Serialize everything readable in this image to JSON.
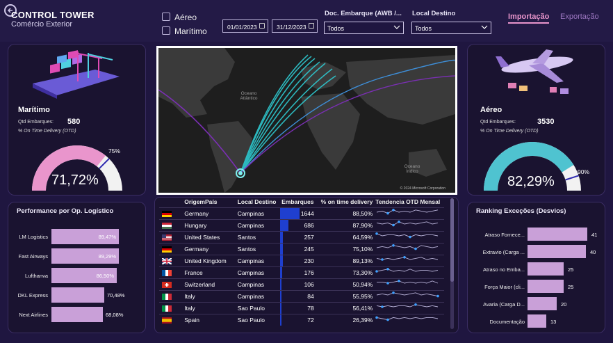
{
  "header": {
    "title": "CONTROL TOWER",
    "subtitle": "Comércio Exterior",
    "filters": {
      "aereo": "Aéreo",
      "maritimo": "Marítimo"
    },
    "date_start": "01/01/2023",
    "date_end": "31/12/2023",
    "doc_label": "Doc. Embarque (AWB /...",
    "doc_value": "Todos",
    "destino_label": "Local Destino",
    "destino_value": "Todos",
    "tab_import": "Importação",
    "tab_export": "Exportação"
  },
  "maritimo": {
    "title": "Marítimo",
    "qtd_label": "Qtd Embarques:",
    "qtd_value": "580",
    "otd_label": "% On Time Delivery (OTD)",
    "gauge_value": "71,72%",
    "gauge_target": "75%",
    "gauge_fraction": 0.7172,
    "color": "#e995cc"
  },
  "aereo": {
    "title": "Aéreo",
    "qtd_label": "Qtd Embarques:",
    "qtd_value": "3530",
    "otd_label": "% On Time Delivery (OTD)",
    "gauge_value": "82,29%",
    "gauge_target": "90%",
    "gauge_fraction": 0.8229,
    "color": "#4fc3d0"
  },
  "map": {
    "ocean1": "Oceano Atlântico",
    "ocean2": "Oceano Índico",
    "credit": "© 2024 Microsoft Corporation"
  },
  "performance": {
    "title": "Performance por Op. Logístico",
    "items": [
      {
        "label": "LM Logistics",
        "value": "89,47%",
        "pct": 89.47
      },
      {
        "label": "Fast Airways",
        "value": "89,29%",
        "pct": 89.29
      },
      {
        "label": "Lufthanva",
        "value": "86,50%",
        "pct": 86.5
      },
      {
        "label": "DKL Express",
        "value": "70,48%",
        "pct": 70.48
      },
      {
        "label": "Next Airlines",
        "value": "68,08%",
        "pct": 68.08
      }
    ]
  },
  "ranking": {
    "title": "Ranking Exceções (Desvios)",
    "items": [
      {
        "label": "Atraso Fornece...",
        "value": "41",
        "n": 41
      },
      {
        "label": "Extravio (Carga ...",
        "value": "40",
        "n": 40
      },
      {
        "label": "Atraso no Emba...",
        "value": "25",
        "n": 25
      },
      {
        "label": "Força Maior (cli...",
        "value": "25",
        "n": 25
      },
      {
        "label": "Avaria (Carga D...",
        "value": "20",
        "n": 20
      },
      {
        "label": "Documentação",
        "value": "13",
        "n": 13
      }
    ]
  },
  "table": {
    "headers": {
      "origem": "OrigemPaís",
      "destino": "Local Destino",
      "emb": "Embarques",
      "otd": "% on time delivery",
      "trend": "Tendencia OTD Mensal"
    },
    "max_emb": 1644,
    "rows": [
      {
        "flag": "de",
        "origem": "Germany",
        "destino": "Campinas",
        "emb": "1644",
        "n": 1644,
        "otd": "88,50%",
        "trend": [
          5,
          6,
          4,
          7,
          5,
          6,
          5,
          7,
          6,
          5,
          6,
          7
        ]
      },
      {
        "flag": "hu",
        "origem": "Hungary",
        "destino": "Campinas",
        "emb": "686",
        "n": 686,
        "otd": "87,90%",
        "trend": [
          6,
          5,
          6,
          4,
          7,
          5,
          6,
          5,
          6,
          7,
          5,
          6
        ]
      },
      {
        "flag": "us",
        "origem": "United States",
        "destino": "Santos",
        "emb": "257",
        "n": 257,
        "otd": "64,59%",
        "trend": [
          7,
          5,
          6,
          6,
          5,
          6,
          4,
          6,
          5,
          6,
          6,
          5
        ]
      },
      {
        "flag": "de",
        "origem": "Germany",
        "destino": "Santos",
        "emb": "245",
        "n": 245,
        "otd": "75,10%",
        "trend": [
          5,
          6,
          5,
          7,
          6,
          5,
          6,
          4,
          7,
          6,
          5,
          6
        ]
      },
      {
        "flag": "gb",
        "origem": "United Kingdom",
        "destino": "Campinas",
        "emb": "230",
        "n": 230,
        "otd": "89,13%",
        "trend": [
          6,
          5,
          6,
          5,
          6,
          7,
          5,
          6,
          7,
          5,
          6,
          5
        ]
      },
      {
        "flag": "fr",
        "origem": "France",
        "destino": "Campinas",
        "emb": "176",
        "n": 176,
        "otd": "73,30%",
        "trend": [
          5,
          6,
          7,
          5,
          6,
          5,
          7,
          5,
          6,
          6,
          5,
          6
        ]
      },
      {
        "flag": "ch",
        "origem": "Switzerland",
        "destino": "Campinas",
        "emb": "106",
        "n": 106,
        "otd": "50,94%",
        "trend": [
          6,
          6,
          5,
          6,
          7,
          5,
          6,
          5,
          6,
          5,
          7,
          5
        ]
      },
      {
        "flag": "it",
        "origem": "Italy",
        "destino": "Campinas",
        "emb": "84",
        "n": 84,
        "otd": "55,95%",
        "trend": [
          5,
          6,
          5,
          7,
          6,
          5,
          6,
          7,
          5,
          6,
          5,
          4
        ]
      },
      {
        "flag": "it",
        "origem": "Italy",
        "destino": "Sao Paulo",
        "emb": "78",
        "n": 78,
        "otd": "56,41%",
        "trend": [
          6,
          5,
          6,
          5,
          6,
          6,
          5,
          7,
          6,
          5,
          6,
          5
        ]
      },
      {
        "flag": "es",
        "origem": "Spain",
        "destino": "Sao Paulo",
        "emb": "72",
        "n": 72,
        "otd": "26,39%",
        "trend": [
          6,
          5,
          4,
          6,
          5,
          6,
          5,
          6,
          5,
          6,
          6,
          5
        ]
      }
    ]
  }
}
